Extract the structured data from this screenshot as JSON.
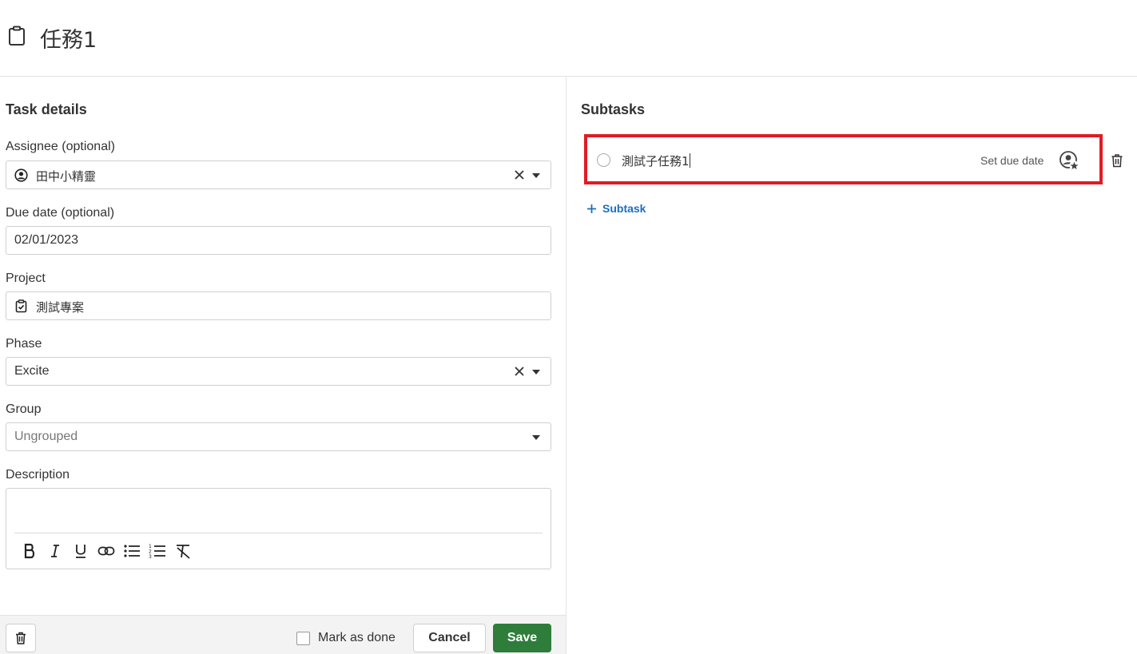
{
  "header": {
    "title": "任務1",
    "icon": "clipboard-icon"
  },
  "details": {
    "section_title": "Task details",
    "assignee": {
      "label": "Assignee (optional)",
      "value": "田中小精靈",
      "icon": "user-circle-icon"
    },
    "due_date": {
      "label": "Due date (optional)",
      "value": "02/01/2023"
    },
    "project": {
      "label": "Project",
      "value": "測試專案",
      "icon": "clipboard-check-icon"
    },
    "phase": {
      "label": "Phase",
      "value": "Excite"
    },
    "group": {
      "label": "Group",
      "placeholder": "Ungrouped"
    },
    "description": {
      "label": "Description",
      "value": ""
    },
    "toolbar": [
      "bold-icon",
      "italic-icon",
      "underline-icon",
      "link-icon",
      "bullet-list-icon",
      "numbered-list-icon",
      "clear-format-icon"
    ]
  },
  "footer": {
    "mark_done_label": "Mark as done",
    "mark_done_checked": false,
    "cancel_label": "Cancel",
    "save_label": "Save",
    "save_color": "#2e7d3a"
  },
  "subtasks": {
    "section_title": "Subtasks",
    "items": [
      {
        "name": "測試子任務1",
        "due_label": "Set due date"
      }
    ],
    "add_label": "Subtask",
    "highlight_color": "#e01b24"
  }
}
